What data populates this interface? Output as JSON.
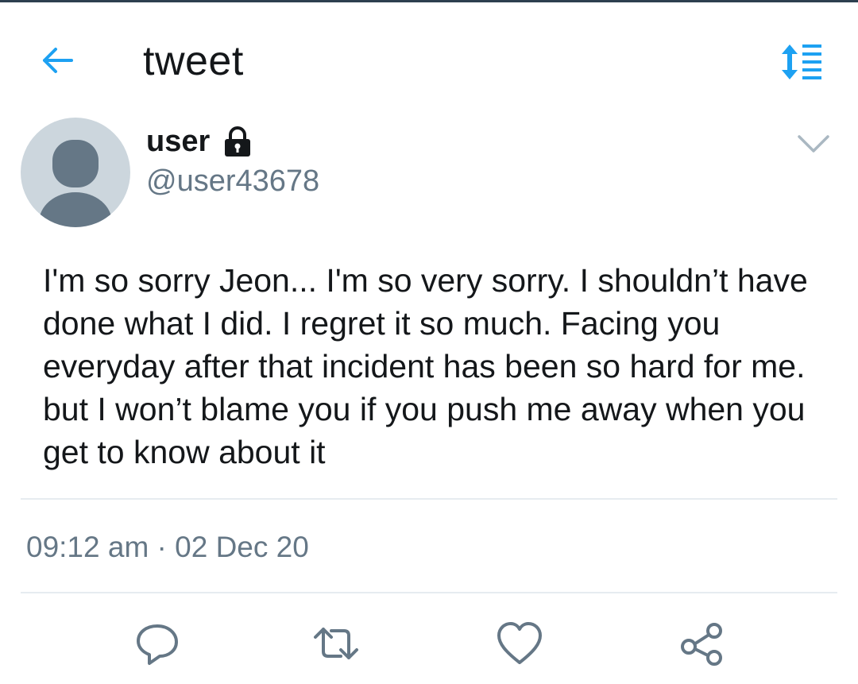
{
  "header": {
    "title": "tweet",
    "back_icon": "arrow-left-icon",
    "sort_icon": "sort-list-icon",
    "accent_color": "#1da1f2"
  },
  "author": {
    "name": "user",
    "handle": "@user43678",
    "protected_icon": "lock-icon",
    "avatar_icon": "default-avatar-icon",
    "menu_icon": "chevron-down-icon"
  },
  "tweet": {
    "text": "I'm so sorry Jeon... I'm so very sorry. I shouldn’t have done what I did. I regret it so much. Facing you everyday after that incident has been so hard for me. but I won’t blame you if you push me away when you get to know about it",
    "timestamp": "09:12 am · 02 Dec 20"
  },
  "actions": [
    {
      "name": "reply",
      "icon": "reply-icon"
    },
    {
      "name": "retweet",
      "icon": "retweet-icon"
    },
    {
      "name": "like",
      "icon": "heart-icon"
    },
    {
      "name": "share",
      "icon": "share-icon"
    }
  ],
  "colors": {
    "text": "#14171a",
    "secondary": "#657786",
    "divider": "#e6ecf0",
    "avatar_bg": "#ccd6dd",
    "avatar_fg": "#657786"
  }
}
